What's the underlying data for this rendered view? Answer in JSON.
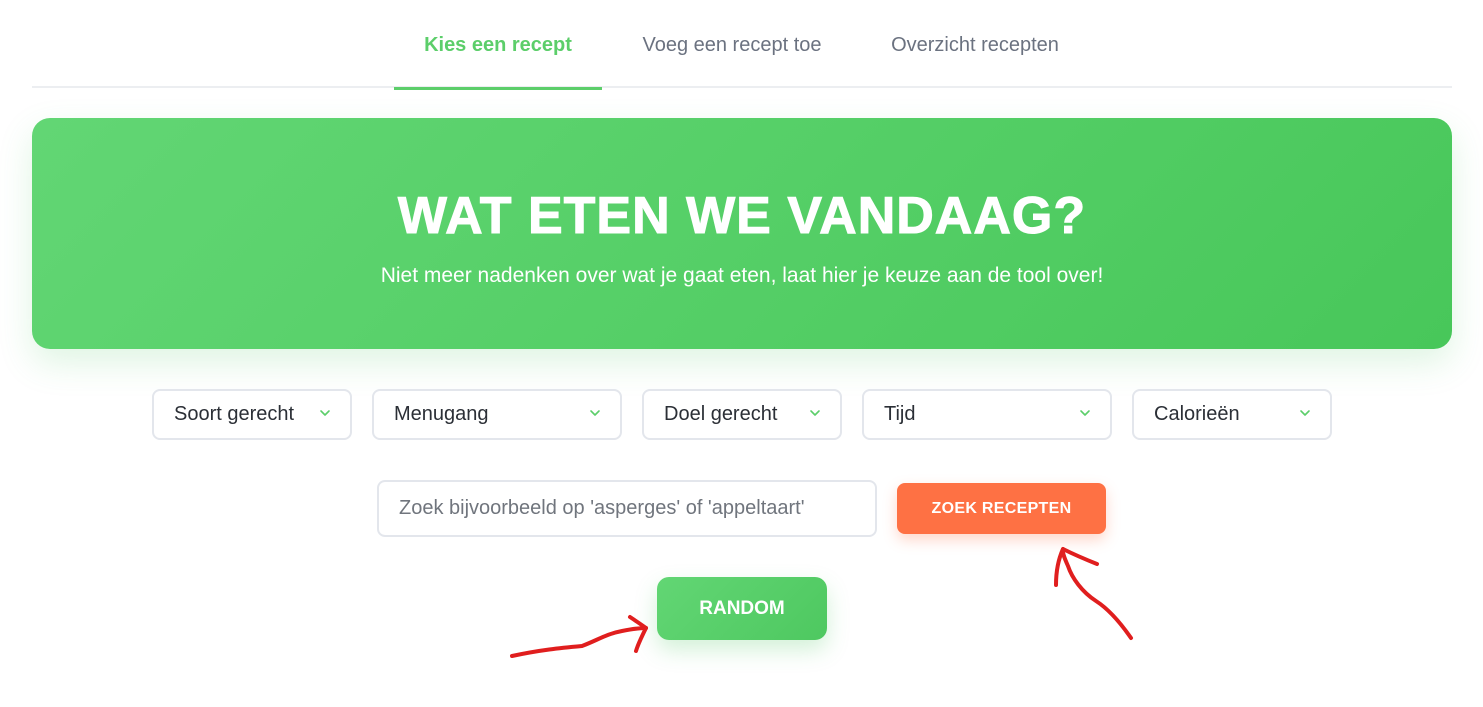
{
  "colors": {
    "accent_green": "#5cce6a",
    "search_button": "#fe7144",
    "annotation_red": "#e01e1e"
  },
  "tabs": [
    {
      "label": "Kies een recept",
      "active": true
    },
    {
      "label": "Voeg een recept toe",
      "active": false
    },
    {
      "label": "Overzicht recepten",
      "active": false
    }
  ],
  "hero": {
    "title": "WAT ETEN WE VANDAAG?",
    "subtitle": "Niet meer nadenken over wat je gaat eten, laat hier je keuze aan de tool over!"
  },
  "filters": [
    {
      "label": "Soort gerecht",
      "icon": "chevron-down-icon"
    },
    {
      "label": "Menugang",
      "icon": "chevron-down-icon"
    },
    {
      "label": "Doel gerecht",
      "icon": "chevron-down-icon"
    },
    {
      "label": "Tijd",
      "icon": "chevron-down-icon"
    },
    {
      "label": "Calorieën",
      "icon": "chevron-down-icon"
    }
  ],
  "search": {
    "value": "",
    "placeholder": "Zoek bijvoorbeeld op 'asperges' of 'appeltaart'",
    "button_label": "ZOEK RECEPTEN"
  },
  "random": {
    "button_label": "RANDOM"
  }
}
